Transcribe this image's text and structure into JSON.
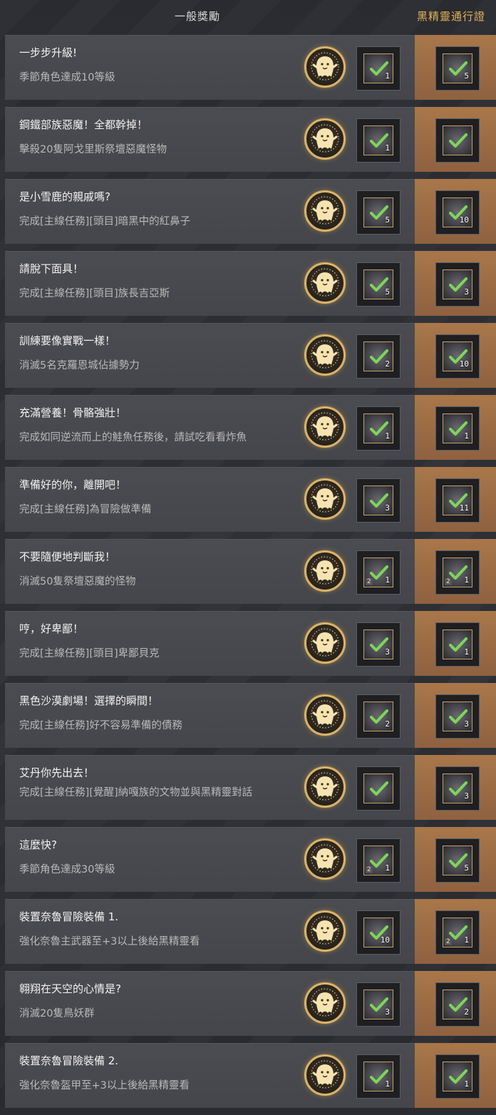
{
  "header": {
    "general_label": "一般獎勵",
    "pass_label": "黑精靈通行證"
  },
  "colors": {
    "pass_accent": "#e3b25a",
    "pass_column": "#a9774a",
    "check": "#7cd65a"
  },
  "rows": [
    {
      "title": "一步步升級!",
      "desc": "季節角色達成10等級",
      "general": {
        "icon": "treasure-chest-icon",
        "qty": "1"
      },
      "pass": {
        "icon": "crystal-shard-icon",
        "qty": "5"
      }
    },
    {
      "title": "鋼鐵部族惡魔！全都幹掉！",
      "desc": "擊殺20隻阿戈里斯祭壇惡魔怪物",
      "general": {
        "icon": "silver-ingot-icon",
        "qty": "1"
      },
      "pass": {
        "icon": "lantern-icon",
        "qty": ""
      }
    },
    {
      "title": "是小雪鹿的親戚嗎?",
      "desc": "完成[主線任務][頭目]暗黑中的紅鼻子",
      "general": {
        "icon": "crystal-shard-icon",
        "qty": "5"
      },
      "pass": {
        "icon": "crystal-shard-icon",
        "qty": "10"
      }
    },
    {
      "title": "請脫下面具！",
      "desc": "完成[主線任務][頭目]族長吉亞斯",
      "general": {
        "icon": "crystal-shard-icon",
        "qty": "5"
      },
      "pass": {
        "icon": "scroll-icon",
        "qty": "3"
      }
    },
    {
      "title": "訓練要像實戰一樣！",
      "desc": "消滅5名克羅恩城佔據勢力",
      "general": {
        "icon": "silver-ingot-icon",
        "qty": "2"
      },
      "pass": {
        "icon": "silver-orb-icon",
        "qty": "10"
      }
    },
    {
      "title": "充滿營養！骨骼強壯！",
      "desc": "完成如同逆流而上的鮭魚任務後，請試吃看看炸魚",
      "general": {
        "icon": "silver-bars-icon",
        "qty": "1"
      },
      "pass": {
        "icon": "black-stone-icon",
        "qty": "1"
      }
    },
    {
      "title": "準備好的你，離開吧！",
      "desc": "完成[主線任務]為冒險做準備",
      "general": {
        "icon": "potion-icon",
        "qty": "3"
      },
      "pass": {
        "icon": "ore-pile-icon",
        "qty": "11"
      }
    },
    {
      "title": "不要隨便地判斷我！",
      "desc": "消滅50隻祭壇惡魔的怪物",
      "general": {
        "icon": "feather-icon",
        "qty": "1",
        "tier": "2"
      },
      "pass": {
        "icon": "feather-icon",
        "qty": "1",
        "tier": "2"
      }
    },
    {
      "title": "哼，好卑鄙！",
      "desc": "完成[主線任務][頭目]卑鄙貝克",
      "general": {
        "icon": "elixir-icon",
        "qty": "3"
      },
      "pass": {
        "icon": "dice-icon",
        "qty": "1"
      }
    },
    {
      "title": "黑色沙漠劇場！選擇的瞬間！",
      "desc": "完成[主線任務]好不容易準備的債務",
      "general": {
        "icon": "silver-coin-icon",
        "qty": "2"
      },
      "pass": {
        "icon": "silver-coins-icon",
        "qty": "3"
      }
    },
    {
      "title": "艾丹你先出去！",
      "desc": "完成[主線任務][覺醒]納嘎族的文物並與黑精靈對話",
      "general": {
        "icon": "amulet-icon",
        "qty": ""
      },
      "pass": {
        "icon": "elixir-icon",
        "qty": "3"
      }
    },
    {
      "title": "這麼快?",
      "desc": "季節角色達成30等級",
      "general": {
        "icon": "feather-icon",
        "qty": "1",
        "tier": "2"
      },
      "pass": {
        "icon": "crystal-shard-icon",
        "qty": "5"
      }
    },
    {
      "title": "裝置奈魯冒險裝備 1.",
      "desc": "強化奈魯主武器至+3以上後給黑精靈看",
      "general": {
        "icon": "black-crystal-icon",
        "qty": "10"
      },
      "pass": {
        "icon": "feather-icon",
        "qty": "1",
        "tier": "2"
      }
    },
    {
      "title": "翱翔在天空的心情是?",
      "desc": "消滅20隻鳥妖群",
      "general": {
        "icon": "elixir-icon",
        "qty": "3"
      },
      "pass": {
        "icon": "elixir-icon",
        "qty": "2"
      }
    },
    {
      "title": "裝置奈魯冒險裝備 2.",
      "desc": "強化奈魯盔甲至+3以上後給黑精靈看",
      "general": {
        "icon": "armor-icon",
        "qty": "1"
      },
      "pass": {
        "icon": "armor-icon",
        "qty": "1"
      }
    }
  ]
}
